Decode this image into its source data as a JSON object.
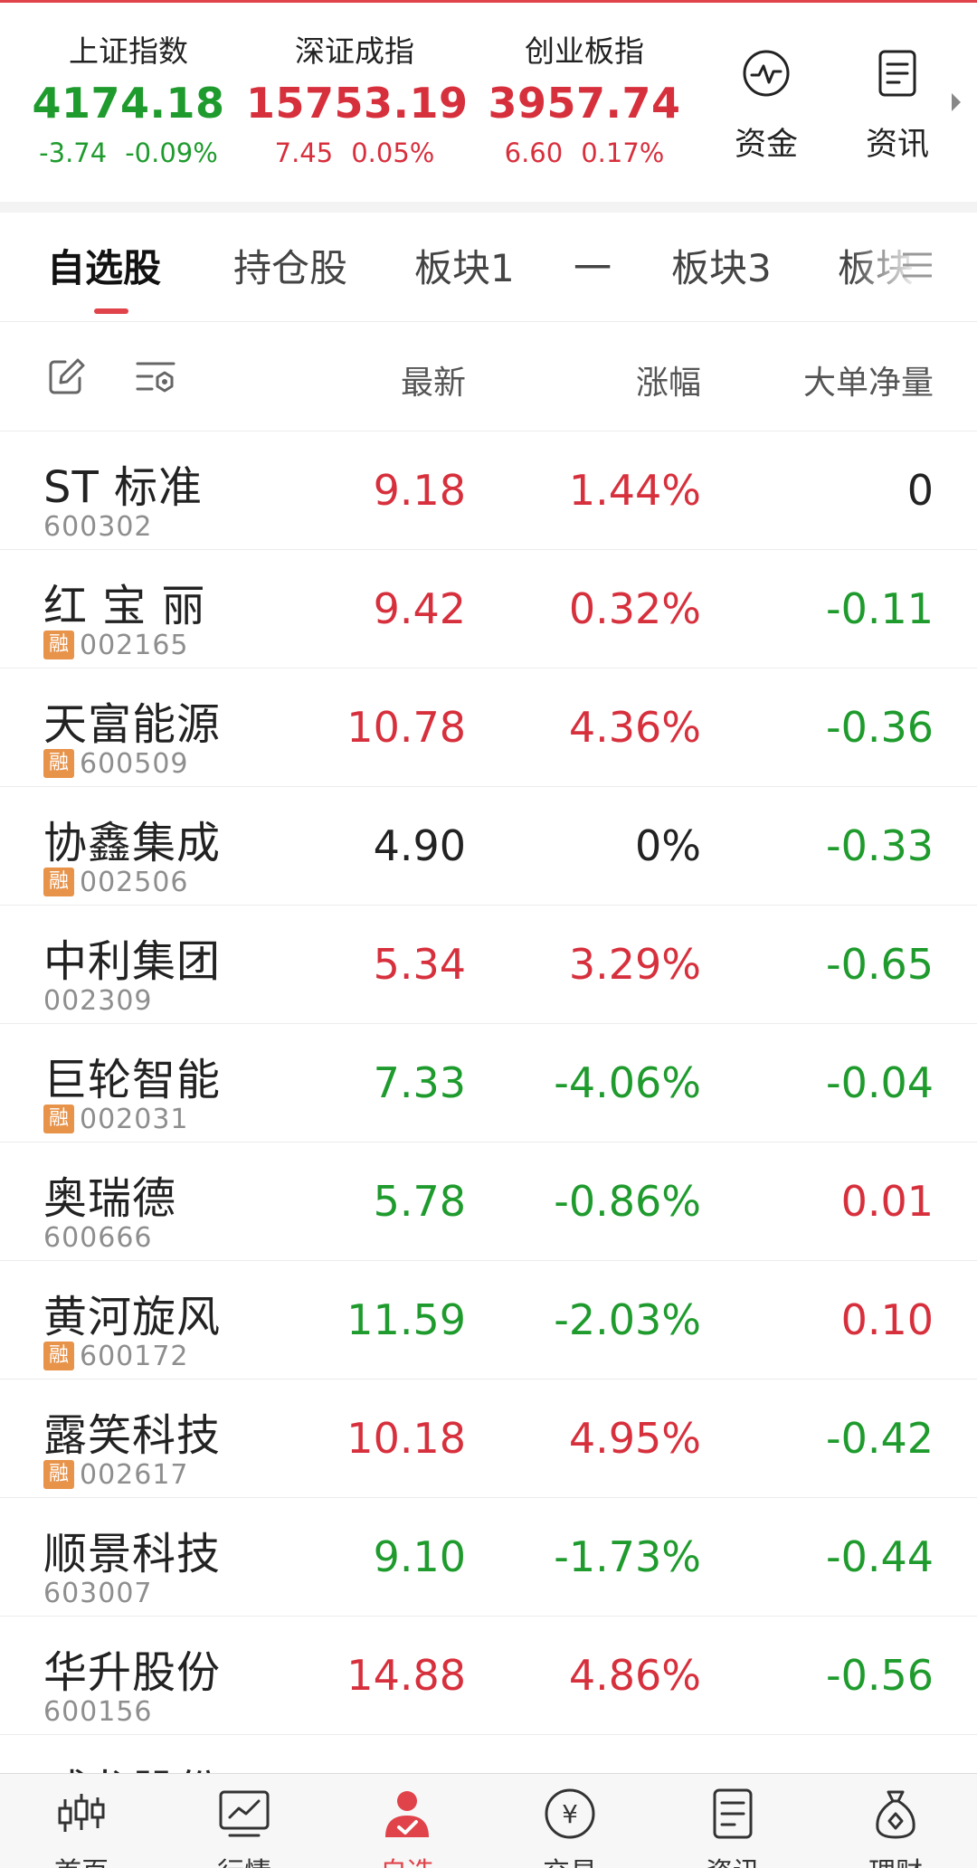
{
  "indices": [
    {
      "name": "上证指数",
      "value": "4174.18",
      "change": "-3.74",
      "percent": "-0.09%",
      "trend": "down"
    },
    {
      "name": "深证成指",
      "value": "15753.19",
      "change": "7.45",
      "percent": "0.05%",
      "trend": "up"
    },
    {
      "name": "创业板指",
      "value": "3957.74",
      "change": "6.60",
      "percent": "0.17%",
      "trend": "up"
    }
  ],
  "shortcuts": [
    {
      "label": "资金",
      "icon": "pulse-circle-icon"
    },
    {
      "label": "资讯",
      "icon": "document-icon"
    }
  ],
  "tabs": [
    {
      "label": "自选股",
      "active": true
    },
    {
      "label": "持仓股",
      "active": false
    },
    {
      "label": "板块1",
      "active": false
    },
    {
      "label": "一",
      "active": false
    },
    {
      "label": "板块3",
      "active": false
    },
    {
      "label": "板块",
      "active": false
    }
  ],
  "columns": {
    "latest": "最新",
    "change": "涨幅",
    "big_order": "大单净量"
  },
  "colors": {
    "up": "#d7303d",
    "down": "#1f9b2e",
    "neutral": "#222222",
    "accent": "#e0434a",
    "margin_tag": "#e8934a"
  },
  "margin_tag_label": "融",
  "stocks": [
    {
      "name": "ST 标准",
      "code": "600302",
      "margin": false,
      "price": "9.18",
      "pct": "1.44%",
      "big": "0",
      "price_c": "up",
      "pct_c": "up",
      "big_c": "neutral"
    },
    {
      "name": "红 宝 丽",
      "code": "002165",
      "margin": true,
      "price": "9.42",
      "pct": "0.32%",
      "big": "-0.11",
      "price_c": "up",
      "pct_c": "up",
      "big_c": "down"
    },
    {
      "name": "天富能源",
      "code": "600509",
      "margin": true,
      "price": "10.78",
      "pct": "4.36%",
      "big": "-0.36",
      "price_c": "up",
      "pct_c": "up",
      "big_c": "down"
    },
    {
      "name": "协鑫集成",
      "code": "002506",
      "margin": true,
      "price": "4.90",
      "pct": "0%",
      "big": "-0.33",
      "price_c": "neutral",
      "pct_c": "neutral",
      "big_c": "down"
    },
    {
      "name": "中利集团",
      "code": "002309",
      "margin": false,
      "price": "5.34",
      "pct": "3.29%",
      "big": "-0.65",
      "price_c": "up",
      "pct_c": "up",
      "big_c": "down"
    },
    {
      "name": "巨轮智能",
      "code": "002031",
      "margin": true,
      "price": "7.33",
      "pct": "-4.06%",
      "big": "-0.04",
      "price_c": "down",
      "pct_c": "down",
      "big_c": "down"
    },
    {
      "name": "奥瑞德",
      "code": "600666",
      "margin": false,
      "price": "5.78",
      "pct": "-0.86%",
      "big": "0.01",
      "price_c": "down",
      "pct_c": "down",
      "big_c": "up"
    },
    {
      "name": "黄河旋风",
      "code": "600172",
      "margin": true,
      "price": "11.59",
      "pct": "-2.03%",
      "big": "0.10",
      "price_c": "down",
      "pct_c": "down",
      "big_c": "up"
    },
    {
      "name": "露笑科技",
      "code": "002617",
      "margin": true,
      "price": "10.18",
      "pct": "4.95%",
      "big": "-0.42",
      "price_c": "up",
      "pct_c": "up",
      "big_c": "down"
    },
    {
      "name": "顺景科技",
      "code": "603007",
      "margin": false,
      "price": "9.10",
      "pct": "-1.73%",
      "big": "-0.44",
      "price_c": "down",
      "pct_c": "down",
      "big_c": "down"
    },
    {
      "name": "华升股份",
      "code": "600156",
      "margin": false,
      "price": "14.88",
      "pct": "4.86%",
      "big": "-0.56",
      "price_c": "up",
      "pct_c": "up",
      "big_c": "down"
    },
    {
      "name": "威龙股份",
      "code": "",
      "margin": false,
      "price": "",
      "pct": "",
      "big": "",
      "price_c": "up",
      "pct_c": "up",
      "big_c": "down"
    }
  ],
  "bottom_nav": [
    {
      "label": "首页",
      "icon": "candlestick-icon",
      "active": false
    },
    {
      "label": "行情",
      "icon": "line-chart-icon",
      "active": false
    },
    {
      "label": "自选",
      "icon": "user-check-icon",
      "active": true
    },
    {
      "label": "交易",
      "icon": "yuan-circle-icon",
      "active": false
    },
    {
      "label": "资讯",
      "icon": "document-icon",
      "active": false
    },
    {
      "label": "理财",
      "icon": "money-bag-icon",
      "active": false
    }
  ]
}
